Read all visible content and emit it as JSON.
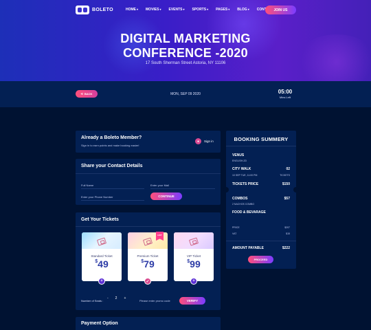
{
  "nav": {
    "logo_text": "BOLETO",
    "menu": [
      {
        "label": "HOME",
        "dropdown": true
      },
      {
        "label": "MOVIES",
        "dropdown": true
      },
      {
        "label": "EVENTS",
        "dropdown": true
      },
      {
        "label": "SPORTS",
        "dropdown": true
      },
      {
        "label": "PAGES",
        "dropdown": true
      },
      {
        "label": "BLOG",
        "dropdown": true
      },
      {
        "label": "CONTACT",
        "dropdown": false
      }
    ],
    "join_label": "JOIN US"
  },
  "hero": {
    "title_line1": "DIGITAL MARKETING",
    "title_line2": "CONFERENCE -2020",
    "address": "17 South Sherman Street Astoria, NY 11106"
  },
  "bar": {
    "back_label": "BACK",
    "date": "MON, SEP 09 2020",
    "timer": "05:00",
    "timer_label": "Mins Left"
  },
  "member": {
    "title": "Already a Boleto Member?",
    "subtitle": "Sign in to earn points and make booking easier!",
    "signin_label": "Sign in"
  },
  "contact": {
    "title": "Share your Contact Details",
    "full_name_placeholder": "Full Name",
    "email_placeholder": "Enter your Mail",
    "phone_placeholder": "Enter your Phone Number",
    "continue_label": "CONTINUE"
  },
  "tickets": {
    "title": "Get Your Tickets",
    "items": [
      {
        "name": "Standard Ticket",
        "currency": "$",
        "price": "49",
        "hot": false,
        "selected": false
      },
      {
        "name": "Premium Ticket",
        "currency": "$",
        "price": "79",
        "hot": true,
        "hot_label": "HOT",
        "selected": true
      },
      {
        "name": "VIP Ticket",
        "currency": "$",
        "price": "99",
        "hot": false,
        "selected": false
      }
    ],
    "seats_label": "Number of Seats :",
    "minus": "-",
    "seat_count": "2",
    "plus": "+",
    "promo_placeholder": "Please enter promo code",
    "verify_label": "VERIFY"
  },
  "payment": {
    "title": "Payment Option"
  },
  "summary": {
    "title": "BOOKING SUMMERY",
    "venue": "VENUS",
    "language": "ENGLISH-2D",
    "city": "CITY WALK",
    "city_count": "02",
    "datetime": "10 SEP TUE, 11:00 PM",
    "tickets_word": "TICKETS",
    "ticket_price_label": "TICKETS PRICE",
    "ticket_price": "$150",
    "combos_label": "COMBOS",
    "combos_price": "$57",
    "combos_desc": "2 NACHOS COMBO",
    "food_label": "FOOD & BEVARAGE",
    "price_label": "PRICE",
    "price_value": "$207",
    "vat_label": "VAT",
    "vat_value": "$15",
    "payable_label": "AMOUNT PAYABLE",
    "payable_value": "$222",
    "proceed_label": "PROCEED"
  },
  "colors": {
    "background": "#001232",
    "card": "#032053",
    "accent_pink": "#ff4f7b",
    "accent_purple": "#7b3cff"
  }
}
